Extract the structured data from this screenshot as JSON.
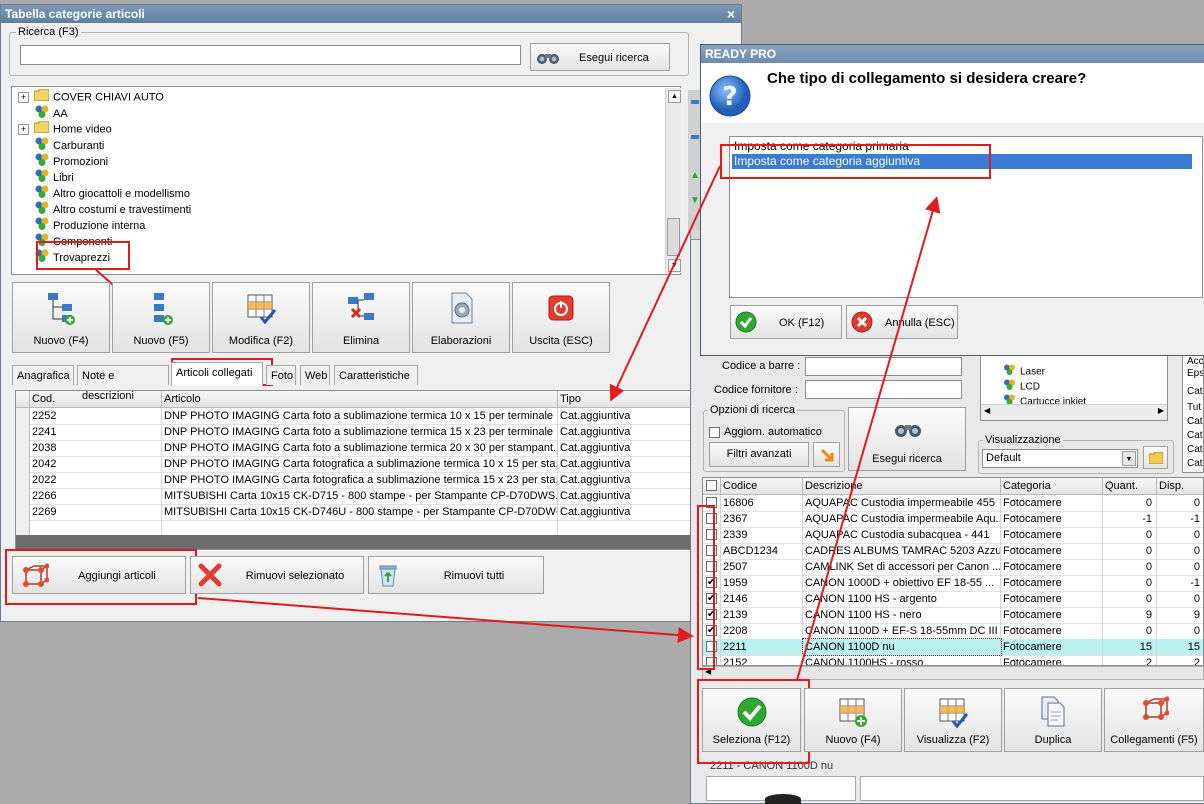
{
  "main_window": {
    "title": "Tabella categorie articoli",
    "close_glyph": "×",
    "search_group_label": "Ricerca (F3)",
    "search_value": "",
    "search_button": "Esegui ricerca",
    "tree_items": [
      {
        "label": "COVER CHIAVI AUTO",
        "kind": "folder",
        "expandable": true
      },
      {
        "label": "AA",
        "kind": "node",
        "expandable": false
      },
      {
        "label": "Home video",
        "kind": "folder",
        "expandable": true
      },
      {
        "label": "Carburanti",
        "kind": "node",
        "expandable": false
      },
      {
        "label": "Promozioni",
        "kind": "node",
        "expandable": false
      },
      {
        "label": "Libri",
        "kind": "node",
        "expandable": false
      },
      {
        "label": "Altro giocattoli e modellismo",
        "kind": "node",
        "expandable": false
      },
      {
        "label": "Altro costumi e travestimenti",
        "kind": "node",
        "expandable": false
      },
      {
        "label": "Produzione interna",
        "kind": "node",
        "expandable": false
      },
      {
        "label": "Componenti",
        "kind": "node",
        "expandable": false
      },
      {
        "label": "Trovaprezzi",
        "kind": "node",
        "expandable": false
      }
    ],
    "toolbar": [
      {
        "label": "Nuovo (F4)",
        "icon": "tree-add-icon"
      },
      {
        "label": "Nuovo (F5)",
        "icon": "tree-child-add-icon"
      },
      {
        "label": "Modifica (F2)",
        "icon": "grid-edit-icon"
      },
      {
        "label": "Elimina",
        "icon": "tree-delete-icon"
      },
      {
        "label": "Elaborazioni",
        "icon": "gear-document-icon"
      },
      {
        "label": "Uscita (ESC)",
        "icon": "exit-icon"
      }
    ],
    "tabs": [
      "Anagrafica",
      "Note e descrizioni",
      "Articoli collegati",
      "Foto",
      "Web",
      "Caratteristiche"
    ],
    "active_tab_index": 2,
    "grid_columns": [
      "Cod.",
      "Articolo",
      "Tipo"
    ],
    "grid_rows": [
      [
        "2252",
        "DNP PHOTO IMAGING Carta foto a sublimazione termica 10 x 15 per terminale ...",
        "Cat.aggiuntiva"
      ],
      [
        "2241",
        "DNP PHOTO IMAGING Carta foto a sublimazione termica 15 x 23 per terminale ...",
        "Cat.aggiuntiva"
      ],
      [
        "2038",
        "DNP PHOTO IMAGING Carta foto a sublimazione termica 20 x 30 per stampant...",
        "Cat.aggiuntiva"
      ],
      [
        "2042",
        "DNP PHOTO IMAGING Carta fotografica a sublimazione termica 10 x 15 per sta...",
        "Cat.aggiuntiva"
      ],
      [
        "2022",
        "DNP PHOTO IMAGING Carta fotografica a sublimazione termica 15 x 23 per sta...",
        "Cat.aggiuntiva"
      ],
      [
        "2266",
        "MITSUBISHI Carta 10x15 CK-D715 - 800 stampe - per Stampante CP-D70DWS...",
        "Cat.aggiuntiva"
      ],
      [
        "2269",
        "MITSUBISHI Carta 10x15 CK-D746U - 800 stampe - per Stampante CP-D70DW-U",
        "Cat.aggiuntiva"
      ]
    ],
    "bottom_buttons": [
      {
        "label": "Aggiungi articoli",
        "icon": "cube-network-icon"
      },
      {
        "label": "Rimuovi selezionato",
        "icon": "red-x-icon"
      },
      {
        "label": "Rimuovi tutti",
        "icon": "recycle-bin-icon"
      }
    ]
  },
  "dialog": {
    "title": "READY PRO",
    "question": "Che tipo di collegamento si desidera creare?",
    "options": [
      "Imposta come categoria primaria",
      "Imposta come categoria aggiuntiva"
    ],
    "selected_index": 1,
    "ok_button": "OK (F12)",
    "cancel_button": "Annulla (ESC)"
  },
  "articles_window": {
    "barcode_label": "Codice a barre :",
    "supplier_label": "Codice fornitore :",
    "options_group": "Opzioni di ricerca",
    "auto_update_label": "Aggiorn. automatico",
    "advanced_filters": "Filtri avanzati",
    "search_button": "Esegui ricerca",
    "view_group": "Visualizzazione",
    "view_value": "Default",
    "tree_items": [
      "Laser",
      "LCD",
      "Cartucce inkjet"
    ],
    "side_texts": [
      "Acc",
      "Eps",
      "Cat",
      "Tut",
      "Cat",
      "Cat",
      "Cat",
      "Cat"
    ],
    "columns": [
      "Codice",
      "Descrizione",
      "Categoria",
      "Quant.",
      "Disp."
    ],
    "rows": [
      {
        "code": "16806",
        "desc": "AQUAPAC Custodia impermeabile 455",
        "cat": "Fotocamere",
        "qty": "0",
        "disp": "0",
        "checked": false
      },
      {
        "code": "2367",
        "desc": "AQUAPAC Custodia impermeabile Aqu...",
        "cat": "Fotocamere",
        "qty": "-1",
        "disp": "-1",
        "checked": false
      },
      {
        "code": "2339",
        "desc": "AQUAPAC Custodia subacquea - 441",
        "cat": "Fotocamere",
        "qty": "0",
        "disp": "0",
        "checked": false
      },
      {
        "code": "ABCD1234",
        "desc": "CADRES ALBUMS TAMRAC 5203 Azzurro",
        "cat": "Fotocamere",
        "qty": "0",
        "disp": "0",
        "checked": false
      },
      {
        "code": "2507",
        "desc": "CAMLINK Set di accessori per Canon ...",
        "cat": "Fotocamere",
        "qty": "0",
        "disp": "0",
        "checked": false
      },
      {
        "code": "1959",
        "desc": "CANON 1000D + obiettivo EF 18-55 ...",
        "cat": "Fotocamere",
        "qty": "0",
        "disp": "-1",
        "checked": true
      },
      {
        "code": "2146",
        "desc": "CANON 1100 HS - argento",
        "cat": "Fotocamere",
        "qty": "0",
        "disp": "0",
        "checked": true
      },
      {
        "code": "2139",
        "desc": "CANON 1100 HS - nero",
        "cat": "Fotocamere",
        "qty": "9",
        "disp": "9",
        "checked": true
      },
      {
        "code": "2208",
        "desc": "CANON 1100D + EF-S 18-55mm DC III",
        "cat": "Fotocamere",
        "qty": "0",
        "disp": "0",
        "checked": true
      },
      {
        "code": "2211",
        "desc": "CANON 1100D nu",
        "cat": "Fotocamere",
        "qty": "15",
        "disp": "15",
        "checked": false
      },
      {
        "code": "2152",
        "desc": "CANON 1100HS - rosso",
        "cat": "Fotocamere",
        "qty": "2",
        "disp": "2",
        "checked": false
      }
    ],
    "highlighted_row": 9,
    "toolbar": [
      {
        "label": "Seleziona (F12)",
        "icon": "green-check-icon"
      },
      {
        "label": "Nuovo (F4)",
        "icon": "grid-add-icon"
      },
      {
        "label": "Visualizza (F2)",
        "icon": "grid-view-icon"
      },
      {
        "label": "Duplica",
        "icon": "duplicate-icon"
      },
      {
        "label": "Collegamenti (F5)",
        "icon": "cube-network-icon"
      }
    ],
    "status_text": "2211 - CANON 1100D nu"
  },
  "colors": {
    "annotation_red": "#e21b1b",
    "selection_blue": "#3a7bd5",
    "highlight_cyan": "#bdf0f0"
  }
}
